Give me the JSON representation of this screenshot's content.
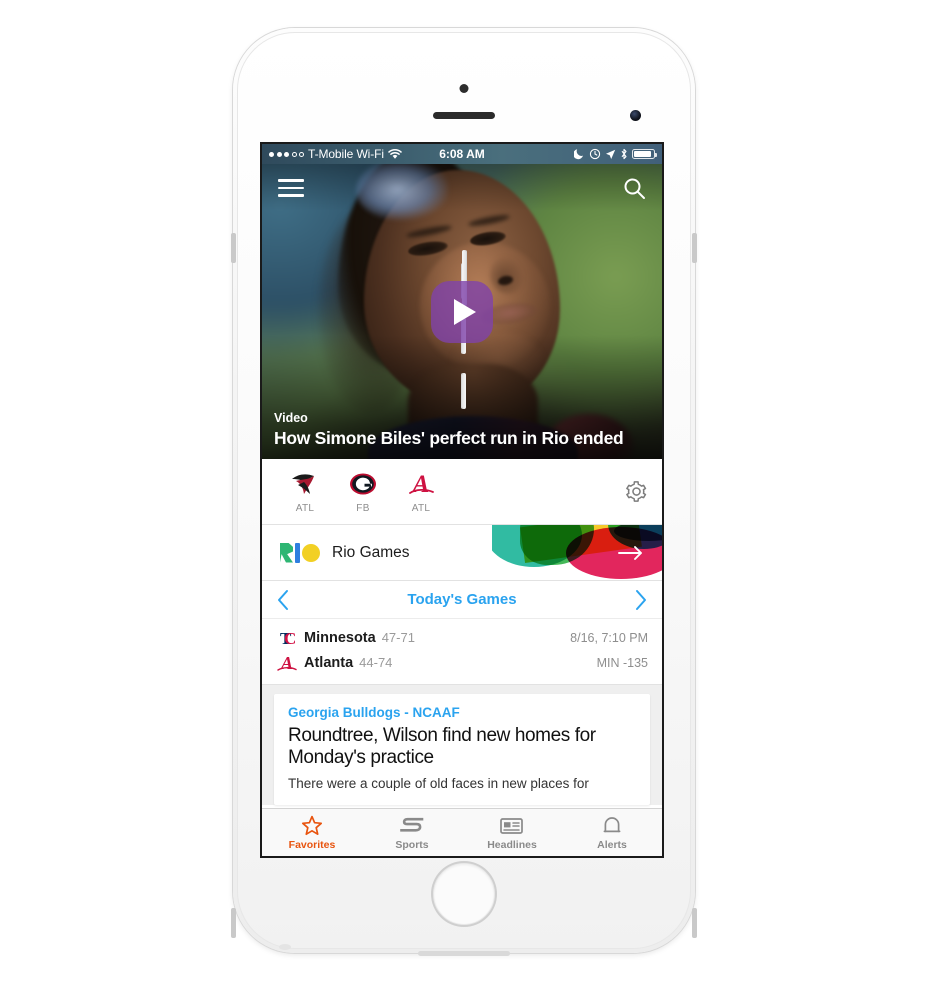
{
  "status_bar": {
    "signal_dots_filled": 3,
    "signal_dots_total": 5,
    "carrier": "T-Mobile Wi-Fi",
    "time": "6:08 AM",
    "icons": [
      "do-not-disturb-moon-icon",
      "alarm-icon",
      "location-arrow-icon",
      "bluetooth-icon",
      "battery-icon"
    ]
  },
  "top_bar": {
    "menu_icon": "hamburger-menu-icon",
    "search_icon": "search-icon"
  },
  "hero": {
    "kicker": "Video",
    "title": "How Simone Biles' perfect run in Rio ended",
    "play_icon": "play-icon",
    "play_button_color": "#8042aa"
  },
  "favorites": {
    "items": [
      {
        "label": "ATL",
        "logo": "atlanta-falcons-logo"
      },
      {
        "label": "FB",
        "logo": "georgia-bulldogs-logo"
      },
      {
        "label": "ATL",
        "logo": "atlanta-braves-logo"
      }
    ],
    "settings_icon": "gear-icon"
  },
  "rio_banner": {
    "label": "Rio Games",
    "logo": "rio-2016-logo",
    "arrow_icon": "arrow-right-icon"
  },
  "scores": {
    "prev_icon": "chevron-left-icon",
    "title": "Today's Games",
    "next_icon": "chevron-right-icon",
    "game": {
      "away": {
        "name": "Minnesota",
        "record": "47-71",
        "logo": "minnesota-twins-logo"
      },
      "home": {
        "name": "Atlanta",
        "record": "44-74",
        "logo": "atlanta-braves-logo"
      },
      "datetime": "8/16, 7:10 PM",
      "odds": "MIN -135"
    }
  },
  "news": {
    "tag": "Georgia Bulldogs - NCAAF",
    "headline": "Roundtree, Wilson find new homes for Monday's practice",
    "excerpt": "There were a couple of old faces in new places for"
  },
  "tabbar": {
    "active_color": "#e8540f",
    "tabs": [
      {
        "label": "Favorites",
        "icon": "star-icon",
        "active": true
      },
      {
        "label": "Sports",
        "icon": "espn-s-icon",
        "active": false
      },
      {
        "label": "Headlines",
        "icon": "newspaper-icon",
        "active": false
      },
      {
        "label": "Alerts",
        "icon": "bell-icon",
        "active": false
      }
    ]
  }
}
